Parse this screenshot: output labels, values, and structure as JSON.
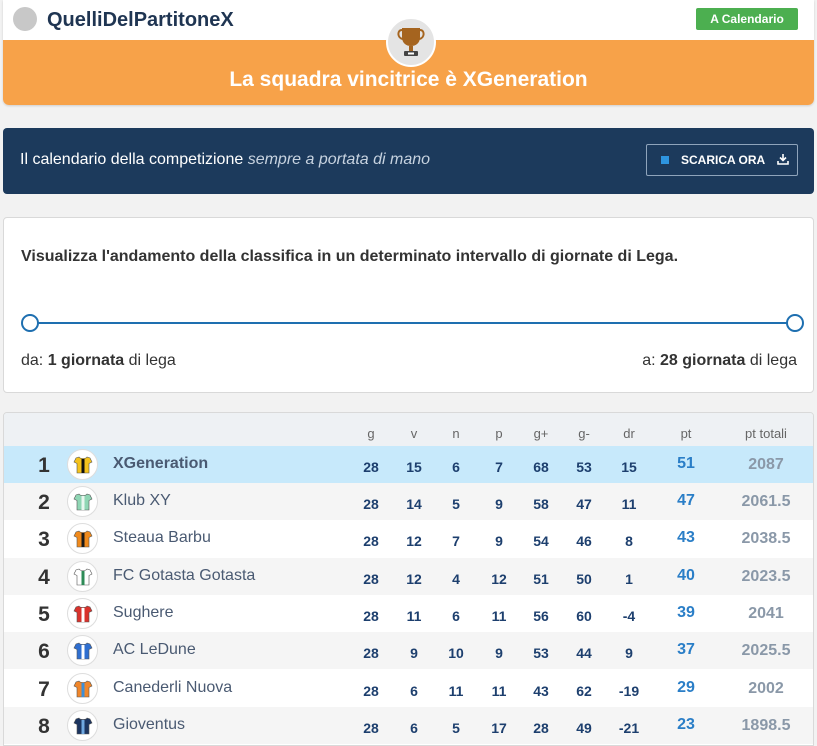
{
  "header": {
    "league_name": "QuelliDelPartitoneX",
    "calendar_button": "A Calendario",
    "winner_text": "La squadra vincitrice è XGeneration"
  },
  "banner": {
    "text_main": "Il calendario della competizione",
    "text_italic": "sempre a portata di mano",
    "download_button": "SCARICA ORA"
  },
  "range": {
    "title": "Visualizza l'andamento della classifica in un determinato intervallo di giornate di Lega.",
    "from_prefix": "da:",
    "from_value": "1 giornata",
    "from_suffix": "di lega",
    "to_prefix": "a:",
    "to_value": "28 giornata",
    "to_suffix": "di lega"
  },
  "table": {
    "headers": [
      "g",
      "v",
      "n",
      "p",
      "g+",
      "g-",
      "dr",
      "pt",
      "pt totali"
    ],
    "rows": [
      {
        "pos": "1",
        "team": "XGeneration",
        "g": "28",
        "v": "15",
        "n": "6",
        "p": "7",
        "gp": "68",
        "gm": "53",
        "dr": "15",
        "pt": "51",
        "tot": "2087",
        "jersey": {
          "body": "#f4c21c",
          "stripe": "#111111"
        }
      },
      {
        "pos": "2",
        "team": "Klub XY",
        "g": "28",
        "v": "14",
        "n": "5",
        "p": "9",
        "gp": "58",
        "gm": "47",
        "dr": "11",
        "pt": "47",
        "tot": "2061.5",
        "jersey": {
          "body": "#8fd6b4",
          "stripe": "#e8f7ef"
        }
      },
      {
        "pos": "3",
        "team": "Steaua Barbu",
        "g": "28",
        "v": "12",
        "n": "7",
        "p": "9",
        "gp": "54",
        "gm": "46",
        "dr": "8",
        "pt": "43",
        "tot": "2038.5",
        "jersey": {
          "body": "#f08a1c",
          "stripe": "#1a1a1a"
        }
      },
      {
        "pos": "4",
        "team": "FC Gotasta Gotasta",
        "g": "28",
        "v": "12",
        "n": "4",
        "p": "12",
        "gp": "51",
        "gm": "50",
        "dr": "1",
        "pt": "40",
        "tot": "2023.5",
        "jersey": {
          "body": "#ffffff",
          "stripe": "#2e8b57"
        }
      },
      {
        "pos": "5",
        "team": "Sughere",
        "g": "28",
        "v": "11",
        "n": "6",
        "p": "11",
        "gp": "56",
        "gm": "60",
        "dr": "-4",
        "pt": "39",
        "tot": "2041",
        "jersey": {
          "body": "#d9322c",
          "stripe": "#ffffff"
        }
      },
      {
        "pos": "6",
        "team": "AC LeDune",
        "g": "28",
        "v": "9",
        "n": "10",
        "p": "9",
        "gp": "53",
        "gm": "44",
        "dr": "9",
        "pt": "37",
        "tot": "2025.5",
        "jersey": {
          "body": "#2f6fd0",
          "stripe": "#ffffff"
        }
      },
      {
        "pos": "7",
        "team": "Canederli Nuova",
        "g": "28",
        "v": "6",
        "n": "11",
        "p": "11",
        "gp": "43",
        "gm": "62",
        "dr": "-19",
        "pt": "29",
        "tot": "2002",
        "jersey": {
          "body": "#f0862a",
          "stripe": "#3c8fd8"
        }
      },
      {
        "pos": "8",
        "team": "Gioventus",
        "g": "28",
        "v": "6",
        "n": "5",
        "p": "17",
        "gp": "28",
        "gm": "49",
        "dr": "-21",
        "pt": "23",
        "tot": "1898.5",
        "jersey": {
          "body": "#1c3560",
          "stripe": "#6fa8e0"
        }
      }
    ]
  }
}
